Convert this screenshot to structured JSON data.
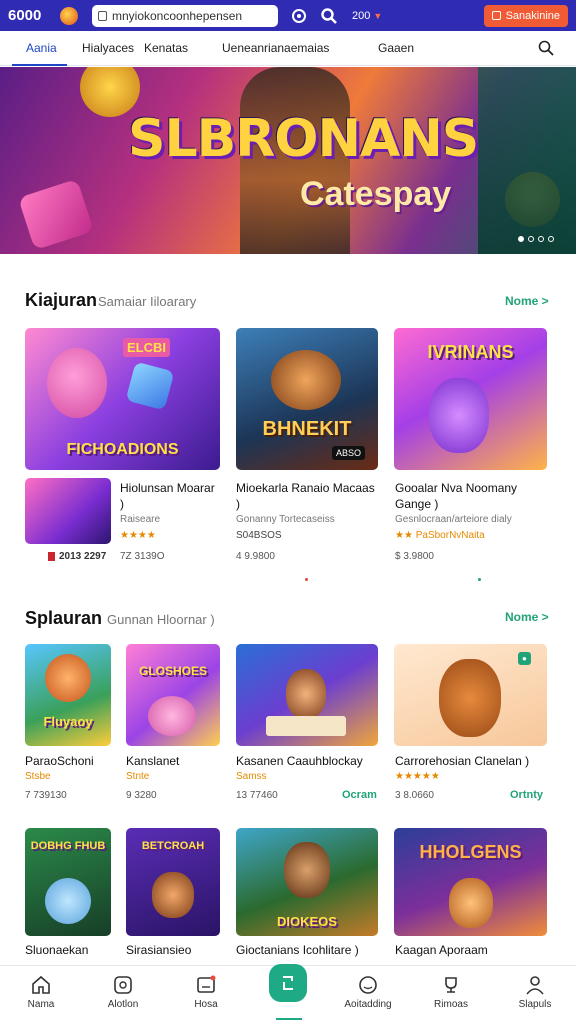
{
  "topbar": {
    "brand": "6000",
    "url": "mnyiokoncoonhepensen",
    "coins": "200",
    "signup_label": "Sanakinine"
  },
  "nav": {
    "tabs": [
      "Aania",
      "Hialyaces",
      "Kenatas",
      "Ueneanrianaemaias",
      "Gaaen"
    ]
  },
  "hero": {
    "title": "SLBRONANS",
    "subtitle": "Catespay"
  },
  "section1": {
    "title": "Kiajuran",
    "subtitle": "Samaiar Iiloarary",
    "more": "Nome >",
    "featured_label": "FICHOADIONS",
    "featured_badge": "ELCBI",
    "card2_label": "BHNEKIT",
    "card2_tag": "ABSO",
    "card3_label": "IVRINANS",
    "games": [
      {
        "name": "Hiolunsan Moarar )",
        "meta": "Raiseare",
        "stars": "★★★★",
        "count": "7Z 3139O"
      },
      {
        "name": "Mioekarla Ranaio Macaas )",
        "meta": "Gonanny Tortecaseiss",
        "rating": "S04BSOS",
        "count": "4 9.9800"
      },
      {
        "name": "Gooalar Nva Noomany Gange )",
        "meta": "Gesnlocraan/arteiore dialy",
        "rating": "★★ PaSborNvNaita",
        "count": "$ 3.9800"
      }
    ],
    "mini_count": "2013 2297"
  },
  "section2": {
    "title": "Splauran",
    "subtitle": "Gunnan Hloornar )",
    "more": "Nome >",
    "games": [
      {
        "name": "ParaoSchoni",
        "label": "Stsbe",
        "count": "7 739130",
        "art": "Fluyaoy"
      },
      {
        "name": "Kanslanet",
        "label": "Stnte",
        "count": "9 3280",
        "art": "GLOSHOES"
      },
      {
        "name": "Kasanen Caauhblockay",
        "label": "Samss",
        "count": "13 77460",
        "action": "Ocram"
      },
      {
        "name": "Carrorehosian Clanelan )",
        "stars": "★★★★★",
        "count": "3 8.0660",
        "action": "Ortnty"
      }
    ]
  },
  "section3": {
    "games": [
      {
        "name": "Sluonaekan",
        "art": "DOBHG FHUB"
      },
      {
        "name": "Sirasiansieo",
        "art": "BETCROAH"
      },
      {
        "name": "Gioctanians Icohlitare )",
        "art": "DIOKEOS"
      },
      {
        "name": "Kaagan Aporaam",
        "art": "HHOLGENS"
      }
    ]
  },
  "bottom_nav": {
    "items": [
      "Nama",
      "Alotlon",
      "Hosa",
      "Aoitadding",
      "Rimoas",
      "Slapuls"
    ]
  }
}
